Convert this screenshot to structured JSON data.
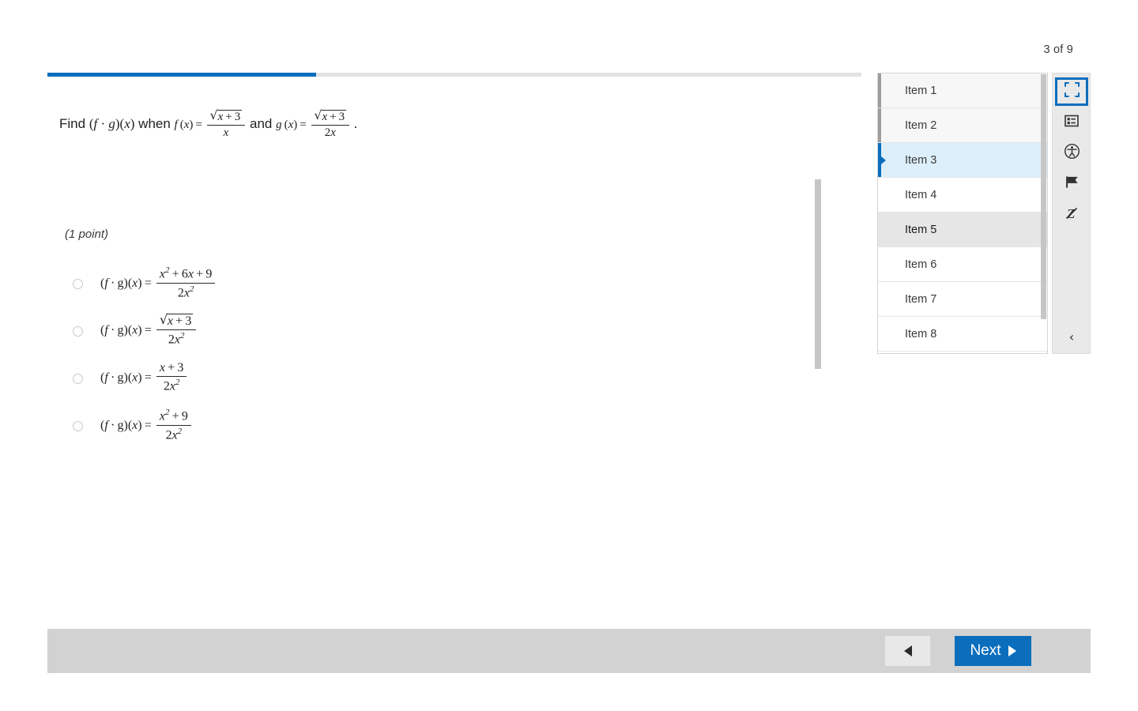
{
  "header": {
    "counter": "3 of 9"
  },
  "progress": {
    "percent": 33,
    "fill_color": "#0a6ebd",
    "track_color": "#e2e2e2"
  },
  "question": {
    "stem_prefix": "Find",
    "stem_fg": "(f · g)(x)",
    "stem_when": "when",
    "stem_f_label": "f (x) =",
    "stem_f_numerator": "√x + 3",
    "stem_f_denominator": "x",
    "stem_and": "and",
    "stem_g_label": "g (x) =",
    "stem_g_numerator": "√x + 3",
    "stem_g_denominator": "2x",
    "stem_period": ".",
    "points": "(1 point)",
    "choices": [
      {
        "lhs": "(f · g)(x) =",
        "numerator": "x² + 6x + 9",
        "denominator": "2x²",
        "selected": false
      },
      {
        "lhs": "(f · g)(x) =",
        "numerator": "√x + 3",
        "denominator": "2x²",
        "selected": false
      },
      {
        "lhs": "(f · g)(x) =",
        "numerator": "x + 3",
        "denominator": "2x²",
        "selected": false
      },
      {
        "lhs": "(f · g)(x) =",
        "numerator": "x² + 9",
        "denominator": "2x²",
        "selected": false
      }
    ]
  },
  "item_list": {
    "items": [
      {
        "label": "Item 1",
        "state": "seen"
      },
      {
        "label": "Item 2",
        "state": "seen"
      },
      {
        "label": "Item 3",
        "state": "current"
      },
      {
        "label": "Item 4",
        "state": "normal"
      },
      {
        "label": "Item 5",
        "state": "hover"
      },
      {
        "label": "Item 6",
        "state": "normal"
      },
      {
        "label": "Item 7",
        "state": "normal"
      },
      {
        "label": "Item 8",
        "state": "normal"
      }
    ]
  },
  "tools": [
    {
      "icon": "fullscreen-icon",
      "active": true
    },
    {
      "icon": "item-list-icon",
      "active": false
    },
    {
      "icon": "accessibility-icon",
      "active": false
    },
    {
      "icon": "flag-icon",
      "active": false
    },
    {
      "icon": "strikethrough-z-icon",
      "active": false
    }
  ],
  "tool_rail": {
    "collapse_icon": "chevron-left-icon",
    "collapse_glyph": "‹"
  },
  "footer": {
    "prev_label": "",
    "next_label": "Next",
    "next_color": "#0a6ebd",
    "bar_color": "#d2d2d2"
  }
}
